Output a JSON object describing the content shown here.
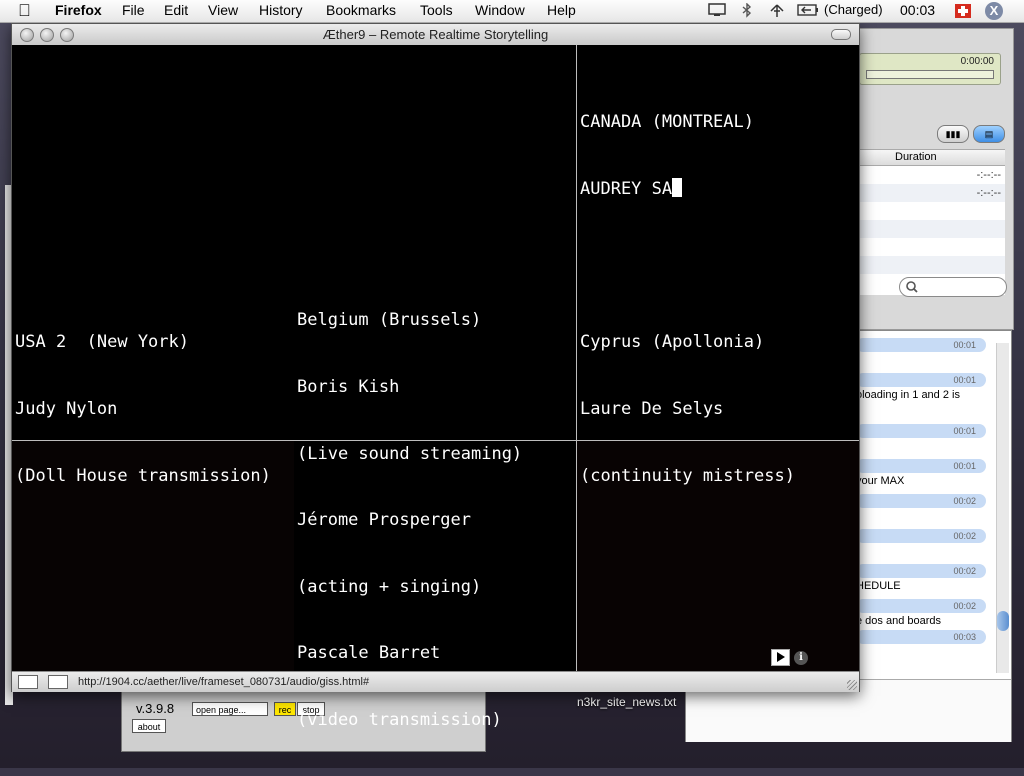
{
  "menubar": {
    "app_name": "Firefox",
    "menus": [
      "File",
      "Edit",
      "View",
      "History",
      "Bookmarks",
      "Tools",
      "Window",
      "Help"
    ],
    "battery": "(Charged)",
    "clock": "00:03"
  },
  "main_window": {
    "title": "Æther9 – Remote Realtime Storytelling",
    "status_url": "http://1904.cc/aether/live/frameset_080731/audio/giss.html#",
    "panels": {
      "top_right": {
        "line1": "CANADA (MONTREAL)",
        "line2": "AUDREY SA"
      },
      "left": {
        "line1": "USA 2  (New York)",
        "line2": "Judy Nylon",
        "line3": "(Doll House transmission)"
      },
      "center": {
        "line1": "Belgium (Brussels)",
        "line2": "Boris Kish",
        "line3": "(Live sound streaming)",
        "line4": "Jérome Prosperger",
        "line5": "(acting + singing)",
        "line6": "Pascale Barret",
        "line7": "(video transmission)"
      },
      "right": {
        "line1": "Cyprus (Apollonia)",
        "line2": "Laure De Selys",
        "line3": "(continuity mistress)"
      }
    }
  },
  "itunes": {
    "time": "0:00:00",
    "column_duration": "Duration",
    "rows": [
      "-:--:--",
      "-:--:--"
    ]
  },
  "chat": {
    "times": [
      "00:01",
      "00:01",
      "00:01",
      "00:01",
      "00:02",
      "00:02",
      "00:02",
      "00:02",
      "00:03"
    ],
    "messages": [
      "oloading in 1 and 2 is",
      "your MAX",
      "HEDULE",
      "e dos and boards"
    ]
  },
  "max_window": {
    "version": "v.3.9.8",
    "open_page": "open page...",
    "rec": "rec",
    "stop": "stop",
    "about": "about"
  },
  "desktop_file": "n3kr_site_news.txt"
}
